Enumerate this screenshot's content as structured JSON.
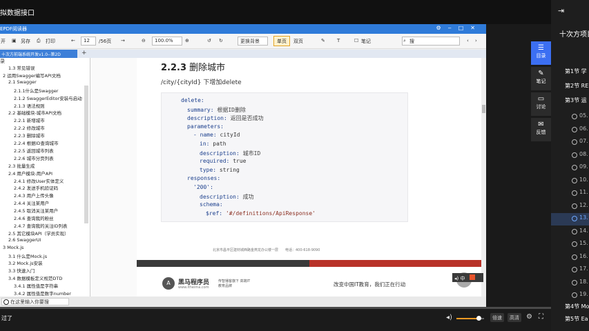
{
  "video": {
    "title": "拟数据接口"
  },
  "course_panel": {
    "title": "十次方项目口",
    "items": [
      {
        "type": "section",
        "label": "第1节 学"
      },
      {
        "type": "section",
        "label": "第2节 RE"
      },
      {
        "type": "section",
        "label": "第3节 运"
      },
      {
        "type": "lesson",
        "label": "05."
      },
      {
        "type": "lesson",
        "label": "06."
      },
      {
        "type": "lesson",
        "label": "07."
      },
      {
        "type": "lesson",
        "label": "08."
      },
      {
        "type": "lesson",
        "label": "09."
      },
      {
        "type": "lesson",
        "label": "10."
      },
      {
        "type": "lesson",
        "label": "11."
      },
      {
        "type": "lesson",
        "label": "12."
      },
      {
        "type": "lesson",
        "label": "13.",
        "active": true
      },
      {
        "type": "lesson",
        "label": "14."
      },
      {
        "type": "lesson",
        "label": "15."
      },
      {
        "type": "lesson",
        "label": "16."
      },
      {
        "type": "lesson",
        "label": "17."
      },
      {
        "type": "lesson",
        "label": "18."
      },
      {
        "type": "lesson",
        "label": "19."
      },
      {
        "type": "section",
        "label": "第4节 Mo"
      },
      {
        "type": "section",
        "label": "第5节 Ea"
      }
    ]
  },
  "side_tools": [
    {
      "label": "目录",
      "icon": "list-icon"
    },
    {
      "label": "笔记",
      "icon": "pencil-icon"
    },
    {
      "label": "讨论",
      "icon": "chat-icon"
    },
    {
      "label": "反馈",
      "icon": "feedback-icon"
    }
  ],
  "pdf": {
    "app_title": "EPDF阅读器",
    "toolbar": {
      "open": "开",
      "save_as": "另存",
      "print": "打印",
      "page_current": "12",
      "page_total": "/56页",
      "zoom": "100.0%",
      "background": "更换背景",
      "single_page": "单页",
      "double_page": "双页",
      "notes": "笔记",
      "search_placeholder": "搜"
    },
    "tab_label": "十次方前端系统开发v1.0--第2D",
    "outline_header": "录",
    "outline": [
      "1.3 常见错误",
      "2 运用Swagger编写API文档",
      "2.1 Swagger",
      "2.1.1什么是Swagger",
      "2.1.2 SwaggerEditor安装与启动",
      "2.1.3 语法规则",
      "2.2 基础模块-城市API文档",
      "2.2.1 新增城市",
      "2.2.2 修改城市",
      "2.2.3 删除城市",
      "2.2.4 根据ID查询城市",
      "2.2.5 返回城市列表",
      "2.2.6 城市分页列表",
      "2.3 批量生成",
      "2.4 用户模块-用户API",
      "2.4.1 修改User实体定义",
      "2.4.2 发送手机验证码",
      "2.4.3 用户上传头像",
      "2.4.4 关注某用户",
      "2.4.5 取消关注某用户",
      "2.4.6 查询我的粉丝",
      "2.4.7 查询我的关注ID列表",
      "2.5 其它模块API（学员实现）",
      "2.6 SwaggerUI",
      "3 Mock.js",
      "3.1 什么是Mock.js",
      "3.2 Mock.js安装",
      "3.3 快速入门",
      "3.4 数据模板定义规范DTD",
      "3.4.1 属性值是字符串",
      "3.4.2 属性值是数字number"
    ],
    "doc": {
      "section_num": "2.2.3",
      "section_title": "删除城市",
      "path_text": "/city/{cityId} 下增加delete",
      "code": [
        {
          "indent": 0,
          "key": "delete:",
          "val": ""
        },
        {
          "indent": 1,
          "key": "summary:",
          "val": "根据ID删除"
        },
        {
          "indent": 1,
          "key": "description:",
          "val": "返回是否成功"
        },
        {
          "indent": 1,
          "key": "parameters:",
          "val": ""
        },
        {
          "indent": 2,
          "key": "- name:",
          "val": "cityId"
        },
        {
          "indent": 3,
          "key": "in:",
          "val": "path"
        },
        {
          "indent": 3,
          "key": "description:",
          "val": "城市ID"
        },
        {
          "indent": 3,
          "key": "required:",
          "val": "true"
        },
        {
          "indent": 3,
          "key": "type:",
          "val": "string"
        },
        {
          "indent": 1,
          "key": "responses:",
          "val": ""
        },
        {
          "indent": 2,
          "key": "'200':",
          "val": ""
        },
        {
          "indent": 3,
          "key": "description:",
          "val": "成功"
        },
        {
          "indent": 3,
          "key": "schema:",
          "val": ""
        },
        {
          "indent": 4,
          "key": "$ref:",
          "val": "'#/definitions/ApiResponse'"
        }
      ],
      "footer_address": "北京市昌平区建材城西路金燕龙办公楼一层　　电话：400-618-9090",
      "brand_name": "黑马程序员",
      "brand_url": "www.itheima.com",
      "brand_tagline": "传智播客旗下 高端IT教育品牌",
      "slogan": "改变中国IT教育，我们正在行动"
    },
    "status_search_placeholder": "在这里输入你要搜",
    "ime": "中"
  },
  "player": {
    "skip_label": "过了",
    "progress": 0.0,
    "volume": 0.8,
    "speed_label": "倍速",
    "quality_label": "高清"
  }
}
